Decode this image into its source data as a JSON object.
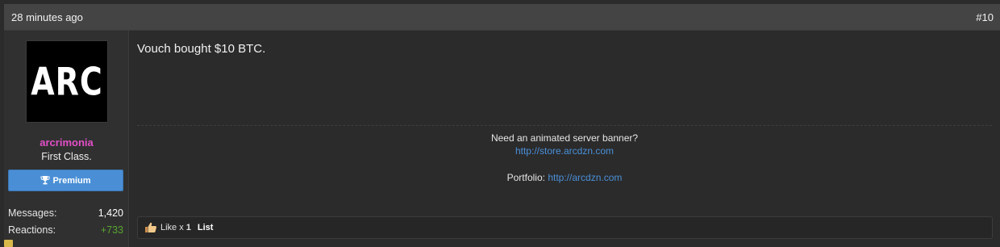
{
  "post": {
    "timestamp": "28 minutes ago",
    "post_number": "#10"
  },
  "user": {
    "avatar_text": "ARC",
    "username": "arcrimonia",
    "title": "First Class.",
    "banner_label": "Premium",
    "banner_icon": "trophy-icon",
    "stats": [
      {
        "label": "Messages:",
        "value": "1,420"
      },
      {
        "label": "Reactions:",
        "value": "+733"
      }
    ]
  },
  "message": {
    "text": "Vouch bought $10 BTC."
  },
  "signature": {
    "line1": "Need an animated server banner?",
    "link1": "http://store.arcdzn.com",
    "portfolio_label": "Portfolio:",
    "link2": "http://arcdzn.com"
  },
  "reactions": {
    "like_label": "Like x",
    "like_count": "1",
    "list_label": "List",
    "icon": "thumbs-up-icon"
  },
  "colors": {
    "username": "#e34fc7",
    "banner": "#4a8fd6",
    "link": "#4a90d9",
    "positive": "#5aa52f"
  }
}
